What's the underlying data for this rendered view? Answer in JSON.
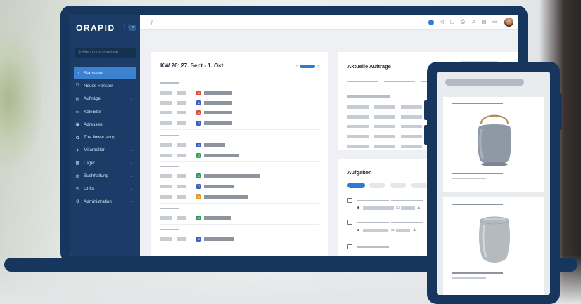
{
  "app": {
    "logo": "ORAPID"
  },
  "sidebar": {
    "search_placeholder": "Menü durchsuchen",
    "items": [
      {
        "label": "Startseite",
        "icon": "home-icon",
        "glyph": "⌂",
        "active": true,
        "chevron": false
      },
      {
        "label": "Neues Fenster",
        "icon": "new-window-icon",
        "glyph": "⧉",
        "active": false,
        "chevron": false
      },
      {
        "label": "Aufträge",
        "icon": "orders-icon",
        "glyph": "▤",
        "active": false,
        "chevron": true
      },
      {
        "label": "Kalender",
        "icon": "calendar-icon",
        "glyph": "▭",
        "active": false,
        "chevron": false
      },
      {
        "label": "Adressen",
        "icon": "address-book-icon",
        "glyph": "▣",
        "active": false,
        "chevron": false
      },
      {
        "label": "The flower shop",
        "icon": "flower-icon",
        "glyph": "✿",
        "active": false,
        "chevron": false
      },
      {
        "label": "Mitarbeiter",
        "icon": "employees-icon",
        "glyph": "✦",
        "active": false,
        "chevron": true
      },
      {
        "label": "Lager",
        "icon": "warehouse-icon",
        "glyph": "▦",
        "active": false,
        "chevron": true
      },
      {
        "label": "Buchhaltung",
        "icon": "accounting-icon",
        "glyph": "▥",
        "active": false,
        "chevron": true
      },
      {
        "label": "Links",
        "icon": "link-icon",
        "glyph": "∞",
        "active": false,
        "chevron": true
      },
      {
        "label": "Administration",
        "icon": "gear-icon",
        "glyph": "⚙",
        "active": false,
        "chevron": true
      }
    ]
  },
  "topbar": {
    "search_icon": "search-icon",
    "icons": [
      "notification-dot-icon",
      "megaphone-icon",
      "chat-icon",
      "print-icon",
      "bell-icon",
      "document-icon",
      "messages-icon"
    ]
  },
  "week": {
    "title": "KW 26: 27. Sept - 1. Okt",
    "prev_glyph": "‹",
    "next_glyph": "›"
  },
  "orders": {
    "title": "Aktuelle Aufträge",
    "select_glyph": "⌄",
    "filter_glyph": "▽"
  },
  "tasks": {
    "title": "Aufgaben"
  },
  "colors": {
    "navy": "#17365d",
    "sidebar": "#1b3c66",
    "accent": "#2e7bd6"
  }
}
